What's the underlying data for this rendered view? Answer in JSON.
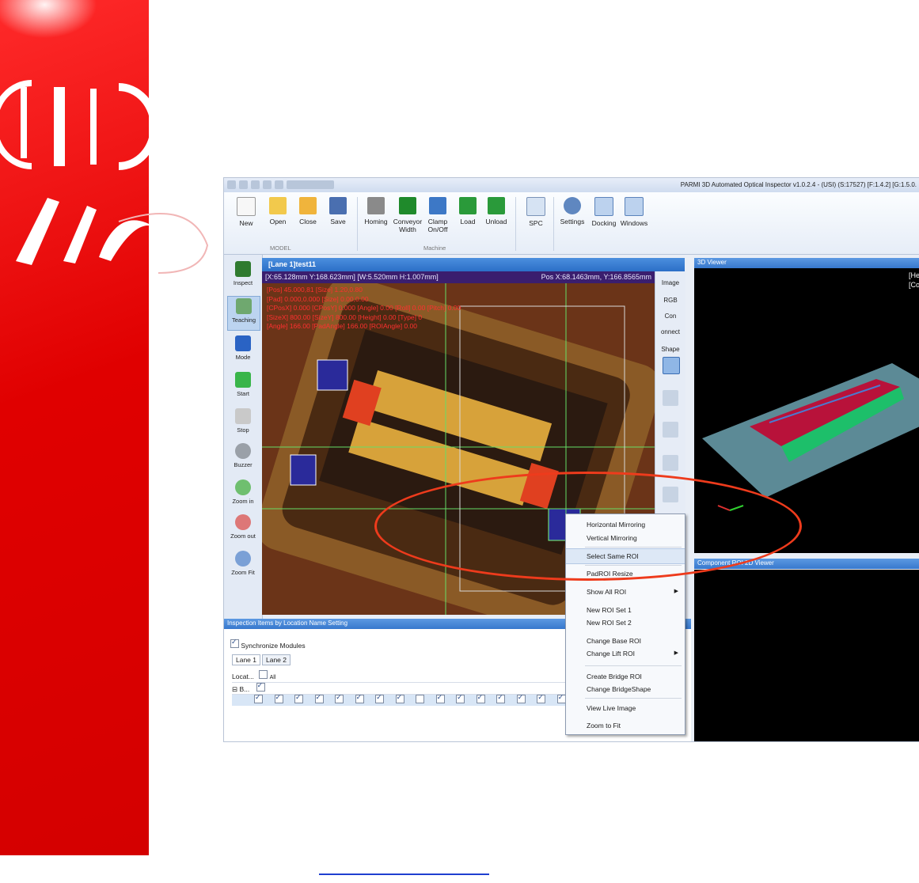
{
  "window": {
    "title": "PARMI 3D Automated Optical Inspector  v1.0.2.4 - (USI) (S:17527) [F:1.4.2] [G:1.5.0."
  },
  "ribbon": {
    "buttons": [
      "New",
      "Open",
      "Close",
      "Save",
      "Homing",
      "Conveyor Width",
      "Clamp On/Off",
      "Load",
      "Unload",
      "SPC",
      "Settings",
      "Docking",
      "Windows"
    ],
    "groups": {
      "model": "MODEL",
      "machine": "Machine"
    }
  },
  "left_toolbar": [
    "Inspect",
    "Teaching",
    "Mode",
    "Start",
    "Stop",
    "Buzzer",
    "Zoom in",
    "Zoom out",
    "Zoom Fit"
  ],
  "viewer": {
    "header": "[Lane 1]test11",
    "coords_left": "[X:65.128mm Y:168.623mm] [W:5.520mm H:1.007mm]",
    "coords_right": "Pos X:68.1463mm, Y:166.8565mm",
    "overlay_lines": [
      "[Pos] 45.000,81 [Size] 1.20,0.80",
      "[Pad] 0.000,0.000 [Size] 0.00,0.00",
      "[CPosX] 0.000 [CPosY] 0.000 [Angle] 0.00 [Roll] 0.00 [Pitch] 0.00",
      "[SizeX] 800.00 [SizeY] 800.00 [Height] 0.00 [Type] 0",
      "[Angle] 166.00 [PadAngle] 166.00 [ROIAngle] 0.00"
    ]
  },
  "right_toolbar": {
    "image": "Image",
    "rgb": "RGB",
    "con": "Con",
    "connect": "onnect",
    "shape": "Shape"
  },
  "panel_3d": {
    "title": "3D Viewer",
    "corner1": "[He",
    "corner2": "[Co"
  },
  "panel_2d": {
    "title": "Component ROI 2D Viewer"
  },
  "inspection": {
    "title": "Inspection Items by Location Name Setting",
    "sync": "Synchronize Modules",
    "tabs": [
      "Lane 1",
      "Lane 2"
    ],
    "col_location": "Locat...",
    "col_all": "All",
    "row_group": "B..."
  },
  "context_menu": [
    {
      "label": "Horizontal Mirroring"
    },
    {
      "label": "Vertical Mirroring"
    },
    {
      "label": "Select Same ROI",
      "highlight": true
    },
    {
      "label": "PadROI Resize"
    },
    {
      "label": "Show All ROI",
      "submenu": true
    },
    {
      "label": "New ROI Set 1"
    },
    {
      "label": "New ROI Set 2"
    },
    {
      "label": "Change Base ROI"
    },
    {
      "label": "Change Lift ROI",
      "submenu": true
    },
    {
      "label": "Create Bridge ROI"
    },
    {
      "label": "Change BridgeShape"
    },
    {
      "label": "View Live Image"
    },
    {
      "label": "Zoom to Fit"
    }
  ],
  "colors": {
    "brand_red": "#e00000",
    "ribbon_blue": "#2c6fc7",
    "annotation": "#ee3b1c"
  }
}
